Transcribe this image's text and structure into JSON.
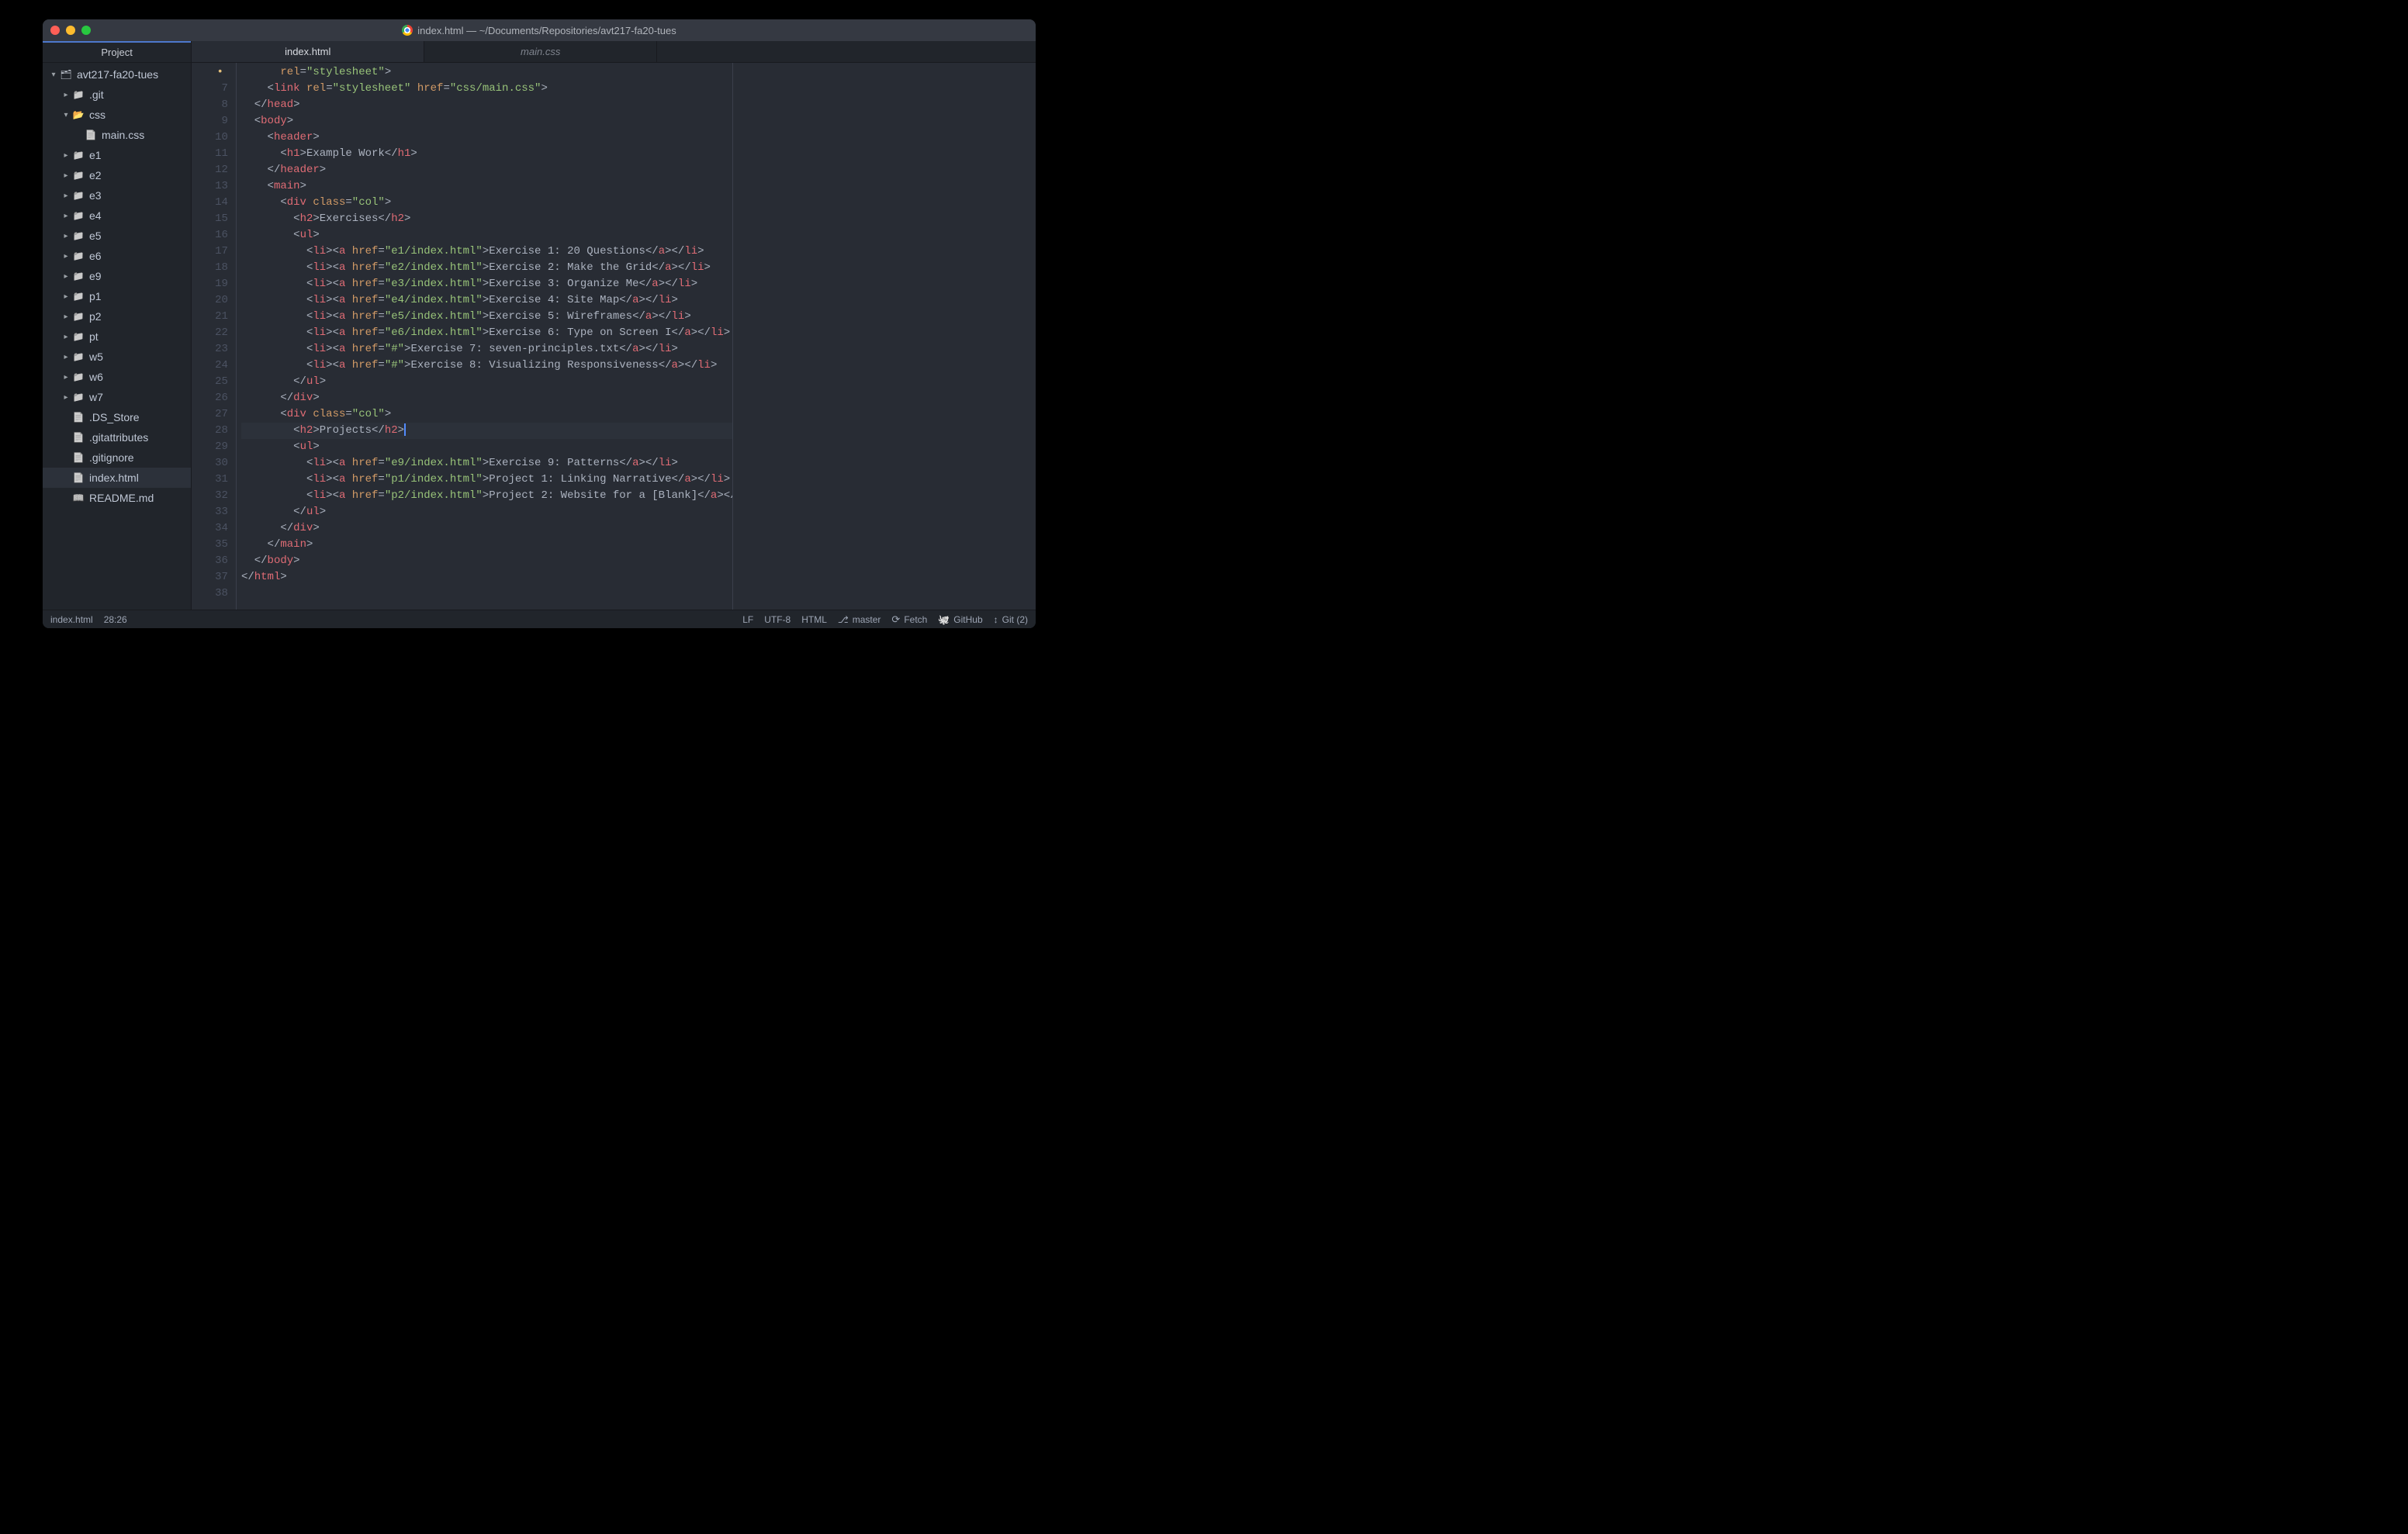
{
  "titlebar": "index.html — ~/Documents/Repositories/avt217-fa20-tues",
  "sidebar": {
    "header": "Project",
    "tree": [
      {
        "depth": 0,
        "expand": "v",
        "icon": "folder-root",
        "label": "avt217-fa20-tues"
      },
      {
        "depth": 1,
        "expand": ">",
        "icon": "folder-closed",
        "label": ".git"
      },
      {
        "depth": 1,
        "expand": "v",
        "icon": "folder-open folder-css",
        "label": "css"
      },
      {
        "depth": 2,
        "expand": "",
        "icon": "file-generic",
        "label": "main.css"
      },
      {
        "depth": 1,
        "expand": ">",
        "icon": "folder-closed",
        "label": "e1"
      },
      {
        "depth": 1,
        "expand": ">",
        "icon": "folder-closed",
        "label": "e2"
      },
      {
        "depth": 1,
        "expand": ">",
        "icon": "folder-closed",
        "label": "e3"
      },
      {
        "depth": 1,
        "expand": ">",
        "icon": "folder-closed",
        "label": "e4"
      },
      {
        "depth": 1,
        "expand": ">",
        "icon": "folder-closed",
        "label": "e5"
      },
      {
        "depth": 1,
        "expand": ">",
        "icon": "folder-closed",
        "label": "e6"
      },
      {
        "depth": 1,
        "expand": ">",
        "icon": "folder-closed",
        "label": "e9"
      },
      {
        "depth": 1,
        "expand": ">",
        "icon": "folder-closed",
        "label": "p1"
      },
      {
        "depth": 1,
        "expand": ">",
        "icon": "folder-closed",
        "label": "p2"
      },
      {
        "depth": 1,
        "expand": ">",
        "icon": "folder-closed",
        "label": "pt"
      },
      {
        "depth": 1,
        "expand": ">",
        "icon": "folder-closed",
        "label": "w5"
      },
      {
        "depth": 1,
        "expand": ">",
        "icon": "folder-closed",
        "label": "w6"
      },
      {
        "depth": 1,
        "expand": ">",
        "icon": "folder-closed",
        "label": "w7"
      },
      {
        "depth": 1,
        "expand": "",
        "icon": "file-generic",
        "label": ".DS_Store"
      },
      {
        "depth": 1,
        "expand": "",
        "icon": "file-generic",
        "label": ".gitattributes"
      },
      {
        "depth": 1,
        "expand": "",
        "icon": "file-generic",
        "label": ".gitignore"
      },
      {
        "depth": 1,
        "expand": "",
        "icon": "file-generic",
        "label": "index.html",
        "selected": true
      },
      {
        "depth": 1,
        "expand": "",
        "icon": "file-book",
        "label": "README.md"
      }
    ]
  },
  "tabs": [
    {
      "label": "index.html",
      "active": true
    },
    {
      "label": "main.css",
      "active": false
    }
  ],
  "editor": {
    "first_line_number": 6,
    "modified_marker_line_index": 0,
    "current_line_index": 22,
    "lines": [
      [
        [
          "punct",
          "      "
        ],
        [
          "attr",
          "rel"
        ],
        [
          "punct",
          "="
        ],
        [
          "str",
          "\"stylesheet\""
        ],
        [
          "punct",
          ">"
        ]
      ],
      [
        [
          "punct",
          "    <"
        ],
        [
          "tag",
          "link"
        ],
        [
          "punct",
          " "
        ],
        [
          "attr",
          "rel"
        ],
        [
          "punct",
          "="
        ],
        [
          "str",
          "\"stylesheet\""
        ],
        [
          "punct",
          " "
        ],
        [
          "attr",
          "href"
        ],
        [
          "punct",
          "="
        ],
        [
          "str",
          "\"css/main.css\""
        ],
        [
          "punct",
          ">"
        ]
      ],
      [
        [
          "punct",
          "  </"
        ],
        [
          "tag",
          "head"
        ],
        [
          "punct",
          ">"
        ]
      ],
      [
        [
          "punct",
          "  <"
        ],
        [
          "tag",
          "body"
        ],
        [
          "punct",
          ">"
        ]
      ],
      [
        [
          "punct",
          "    <"
        ],
        [
          "tag",
          "header"
        ],
        [
          "punct",
          ">"
        ]
      ],
      [
        [
          "punct",
          "      <"
        ],
        [
          "tag",
          "h1"
        ],
        [
          "punct",
          ">"
        ],
        [
          "text",
          "Example Work"
        ],
        [
          "punct",
          "</"
        ],
        [
          "tag",
          "h1"
        ],
        [
          "punct",
          ">"
        ]
      ],
      [
        [
          "punct",
          "    </"
        ],
        [
          "tag",
          "header"
        ],
        [
          "punct",
          ">"
        ]
      ],
      [
        [
          "punct",
          "    <"
        ],
        [
          "tag",
          "main"
        ],
        [
          "punct",
          ">"
        ]
      ],
      [
        [
          "punct",
          "      <"
        ],
        [
          "tag",
          "div"
        ],
        [
          "punct",
          " "
        ],
        [
          "attr",
          "class"
        ],
        [
          "punct",
          "="
        ],
        [
          "str",
          "\"col\""
        ],
        [
          "punct",
          ">"
        ]
      ],
      [
        [
          "punct",
          "        <"
        ],
        [
          "tag",
          "h2"
        ],
        [
          "punct",
          ">"
        ],
        [
          "text",
          "Exercises"
        ],
        [
          "punct",
          "</"
        ],
        [
          "tag",
          "h2"
        ],
        [
          "punct",
          ">"
        ]
      ],
      [
        [
          "punct",
          "        <"
        ],
        [
          "tag",
          "ul"
        ],
        [
          "punct",
          ">"
        ]
      ],
      [
        [
          "punct",
          "          <"
        ],
        [
          "tag",
          "li"
        ],
        [
          "punct",
          "><"
        ],
        [
          "tag",
          "a"
        ],
        [
          "punct",
          " "
        ],
        [
          "attr",
          "href"
        ],
        [
          "punct",
          "="
        ],
        [
          "str",
          "\"e1/index.html\""
        ],
        [
          "punct",
          ">"
        ],
        [
          "text",
          "Exercise 1: 20 Questions"
        ],
        [
          "punct",
          "</"
        ],
        [
          "tag",
          "a"
        ],
        [
          "punct",
          "></"
        ],
        [
          "tag",
          "li"
        ],
        [
          "punct",
          ">"
        ]
      ],
      [
        [
          "punct",
          "          <"
        ],
        [
          "tag",
          "li"
        ],
        [
          "punct",
          "><"
        ],
        [
          "tag",
          "a"
        ],
        [
          "punct",
          " "
        ],
        [
          "attr",
          "href"
        ],
        [
          "punct",
          "="
        ],
        [
          "str",
          "\"e2/index.html\""
        ],
        [
          "punct",
          ">"
        ],
        [
          "text",
          "Exercise 2: Make the Grid"
        ],
        [
          "punct",
          "</"
        ],
        [
          "tag",
          "a"
        ],
        [
          "punct",
          "></"
        ],
        [
          "tag",
          "li"
        ],
        [
          "punct",
          ">"
        ]
      ],
      [
        [
          "punct",
          "          <"
        ],
        [
          "tag",
          "li"
        ],
        [
          "punct",
          "><"
        ],
        [
          "tag",
          "a"
        ],
        [
          "punct",
          " "
        ],
        [
          "attr",
          "href"
        ],
        [
          "punct",
          "="
        ],
        [
          "str",
          "\"e3/index.html\""
        ],
        [
          "punct",
          ">"
        ],
        [
          "text",
          "Exercise 3: Organize Me"
        ],
        [
          "punct",
          "</"
        ],
        [
          "tag",
          "a"
        ],
        [
          "punct",
          "></"
        ],
        [
          "tag",
          "li"
        ],
        [
          "punct",
          ">"
        ]
      ],
      [
        [
          "punct",
          "          <"
        ],
        [
          "tag",
          "li"
        ],
        [
          "punct",
          "><"
        ],
        [
          "tag",
          "a"
        ],
        [
          "punct",
          " "
        ],
        [
          "attr",
          "href"
        ],
        [
          "punct",
          "="
        ],
        [
          "str",
          "\"e4/index.html\""
        ],
        [
          "punct",
          ">"
        ],
        [
          "text",
          "Exercise 4: Site Map"
        ],
        [
          "punct",
          "</"
        ],
        [
          "tag",
          "a"
        ],
        [
          "punct",
          "></"
        ],
        [
          "tag",
          "li"
        ],
        [
          "punct",
          ">"
        ]
      ],
      [
        [
          "punct",
          "          <"
        ],
        [
          "tag",
          "li"
        ],
        [
          "punct",
          "><"
        ],
        [
          "tag",
          "a"
        ],
        [
          "punct",
          " "
        ],
        [
          "attr",
          "href"
        ],
        [
          "punct",
          "="
        ],
        [
          "str",
          "\"e5/index.html\""
        ],
        [
          "punct",
          ">"
        ],
        [
          "text",
          "Exercise 5: Wireframes"
        ],
        [
          "punct",
          "</"
        ],
        [
          "tag",
          "a"
        ],
        [
          "punct",
          "></"
        ],
        [
          "tag",
          "li"
        ],
        [
          "punct",
          ">"
        ]
      ],
      [
        [
          "punct",
          "          <"
        ],
        [
          "tag",
          "li"
        ],
        [
          "punct",
          "><"
        ],
        [
          "tag",
          "a"
        ],
        [
          "punct",
          " "
        ],
        [
          "attr",
          "href"
        ],
        [
          "punct",
          "="
        ],
        [
          "str",
          "\"e6/index.html\""
        ],
        [
          "punct",
          ">"
        ],
        [
          "text",
          "Exercise 6: Type on Screen I"
        ],
        [
          "punct",
          "</"
        ],
        [
          "tag",
          "a"
        ],
        [
          "punct",
          "></"
        ],
        [
          "tag",
          "li"
        ],
        [
          "punct",
          ">"
        ]
      ],
      [
        [
          "punct",
          "          <"
        ],
        [
          "tag",
          "li"
        ],
        [
          "punct",
          "><"
        ],
        [
          "tag",
          "a"
        ],
        [
          "punct",
          " "
        ],
        [
          "attr",
          "href"
        ],
        [
          "punct",
          "="
        ],
        [
          "str",
          "\"#\""
        ],
        [
          "punct",
          ">"
        ],
        [
          "text",
          "Exercise 7: seven-principles.txt"
        ],
        [
          "punct",
          "</"
        ],
        [
          "tag",
          "a"
        ],
        [
          "punct",
          "></"
        ],
        [
          "tag",
          "li"
        ],
        [
          "punct",
          ">"
        ]
      ],
      [
        [
          "punct",
          "          <"
        ],
        [
          "tag",
          "li"
        ],
        [
          "punct",
          "><"
        ],
        [
          "tag",
          "a"
        ],
        [
          "punct",
          " "
        ],
        [
          "attr",
          "href"
        ],
        [
          "punct",
          "="
        ],
        [
          "str",
          "\"#\""
        ],
        [
          "punct",
          ">"
        ],
        [
          "text",
          "Exercise 8: Visualizing Responsiveness"
        ],
        [
          "punct",
          "</"
        ],
        [
          "tag",
          "a"
        ],
        [
          "punct",
          "></"
        ],
        [
          "tag",
          "li"
        ],
        [
          "punct",
          ">"
        ]
      ],
      [
        [
          "punct",
          "        </"
        ],
        [
          "tag",
          "ul"
        ],
        [
          "punct",
          ">"
        ]
      ],
      [
        [
          "punct",
          "      </"
        ],
        [
          "tag",
          "div"
        ],
        [
          "punct",
          ">"
        ]
      ],
      [
        [
          "punct",
          "      <"
        ],
        [
          "tag",
          "div"
        ],
        [
          "punct",
          " "
        ],
        [
          "attr",
          "class"
        ],
        [
          "punct",
          "="
        ],
        [
          "str",
          "\"col\""
        ],
        [
          "punct",
          ">"
        ]
      ],
      [
        [
          "punct",
          "        <"
        ],
        [
          "tag",
          "h2"
        ],
        [
          "punct",
          ">"
        ],
        [
          "text",
          "Projects"
        ],
        [
          "punct",
          "</"
        ],
        [
          "tag",
          "h2"
        ],
        [
          "punct",
          ">"
        ]
      ],
      [
        [
          "punct",
          "        <"
        ],
        [
          "tag",
          "ul"
        ],
        [
          "punct",
          ">"
        ]
      ],
      [
        [
          "punct",
          "          <"
        ],
        [
          "tag",
          "li"
        ],
        [
          "punct",
          "><"
        ],
        [
          "tag",
          "a"
        ],
        [
          "punct",
          " "
        ],
        [
          "attr",
          "href"
        ],
        [
          "punct",
          "="
        ],
        [
          "str",
          "\"e9/index.html\""
        ],
        [
          "punct",
          ">"
        ],
        [
          "text",
          "Exercise 9: Patterns"
        ],
        [
          "punct",
          "</"
        ],
        [
          "tag",
          "a"
        ],
        [
          "punct",
          "></"
        ],
        [
          "tag",
          "li"
        ],
        [
          "punct",
          ">"
        ]
      ],
      [
        [
          "punct",
          "          <"
        ],
        [
          "tag",
          "li"
        ],
        [
          "punct",
          "><"
        ],
        [
          "tag",
          "a"
        ],
        [
          "punct",
          " "
        ],
        [
          "attr",
          "href"
        ],
        [
          "punct",
          "="
        ],
        [
          "str",
          "\"p1/index.html\""
        ],
        [
          "punct",
          ">"
        ],
        [
          "text",
          "Project 1: Linking Narrative"
        ],
        [
          "punct",
          "</"
        ],
        [
          "tag",
          "a"
        ],
        [
          "punct",
          "></"
        ],
        [
          "tag",
          "li"
        ],
        [
          "punct",
          ">"
        ]
      ],
      [
        [
          "punct",
          "          <"
        ],
        [
          "tag",
          "li"
        ],
        [
          "punct",
          "><"
        ],
        [
          "tag",
          "a"
        ],
        [
          "punct",
          " "
        ],
        [
          "attr",
          "href"
        ],
        [
          "punct",
          "="
        ],
        [
          "str",
          "\"p2/index.html\""
        ],
        [
          "punct",
          ">"
        ],
        [
          "text",
          "Project 2: Website for a [Blank]"
        ],
        [
          "punct",
          "</"
        ],
        [
          "tag",
          "a"
        ],
        [
          "punct",
          "></"
        ],
        [
          "tag",
          "li"
        ],
        [
          "punct",
          ">"
        ]
      ],
      [
        [
          "punct",
          "        </"
        ],
        [
          "tag",
          "ul"
        ],
        [
          "punct",
          ">"
        ]
      ],
      [
        [
          "punct",
          "      </"
        ],
        [
          "tag",
          "div"
        ],
        [
          "punct",
          ">"
        ]
      ],
      [
        [
          "punct",
          "    </"
        ],
        [
          "tag",
          "main"
        ],
        [
          "punct",
          ">"
        ]
      ],
      [
        [
          "punct",
          "  </"
        ],
        [
          "tag",
          "body"
        ],
        [
          "punct",
          ">"
        ]
      ],
      [
        [
          "punct",
          "</"
        ],
        [
          "tag",
          "html"
        ],
        [
          "punct",
          ">"
        ]
      ],
      []
    ]
  },
  "status": {
    "file": "index.html",
    "cursor": "28:26",
    "lf": "LF",
    "encoding": "UTF-8",
    "language": "HTML",
    "branch": "master",
    "fetch": "Fetch",
    "github": "GitHub",
    "git": "Git (2)"
  }
}
